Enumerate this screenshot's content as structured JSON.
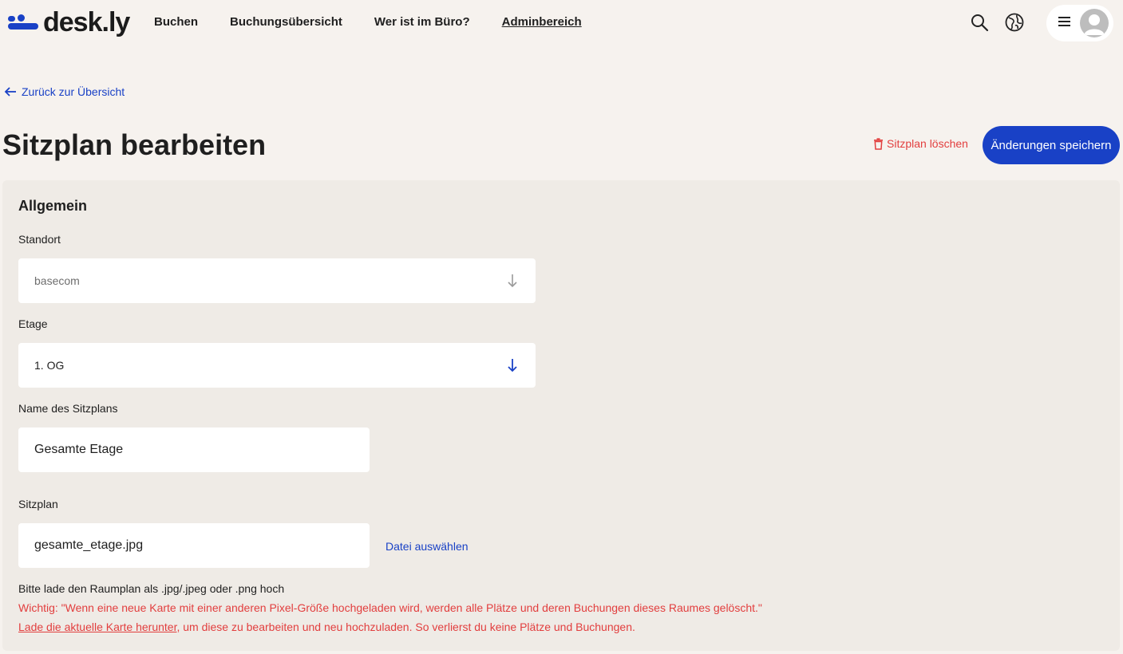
{
  "brand": {
    "name": "desk.ly",
    "accent": "#1941c6",
    "danger": "#e23e3e"
  },
  "nav": {
    "items": [
      {
        "label": "Buchen"
      },
      {
        "label": "Buchungsübersicht"
      },
      {
        "label": "Wer ist im Büro?"
      },
      {
        "label": "Adminbereich",
        "active": true
      }
    ],
    "icons": [
      "search-icon",
      "globe-icon",
      "menu-icon",
      "avatar"
    ]
  },
  "back_link": "Zurück zur Übersicht",
  "page_title": "Sitzplan bearbeiten",
  "actions": {
    "delete_label": "Sitzplan löschen",
    "save_label": "Änderungen speichern"
  },
  "section": {
    "title": "Allgemein",
    "standort": {
      "label": "Standort",
      "value": "basecom"
    },
    "etage": {
      "label": "Etage",
      "value": "1. OG"
    },
    "name": {
      "label": "Name des Sitzplans",
      "value": "Gesamte Etage"
    },
    "sitzplan": {
      "label": "Sitzplan",
      "value": "gesamte_etage.jpg",
      "choose_label": "Datei auswählen"
    },
    "hint_format": "Bitte lade den Raumplan als .jpg/.jpeg oder .png hoch",
    "hint_warning": "Wichtig: \"Wenn eine neue Karte mit einer anderen Pixel-Größe hochgeladen wird, werden alle Plätze und deren Buchungen dieses Raumes gelöscht.\"",
    "hint_download_link": "Lade die aktuelle Karte herunter",
    "hint_download_rest": ", um diese zu bearbeiten und neu hochzuladen. So verlierst du keine Plätze und Buchungen."
  }
}
